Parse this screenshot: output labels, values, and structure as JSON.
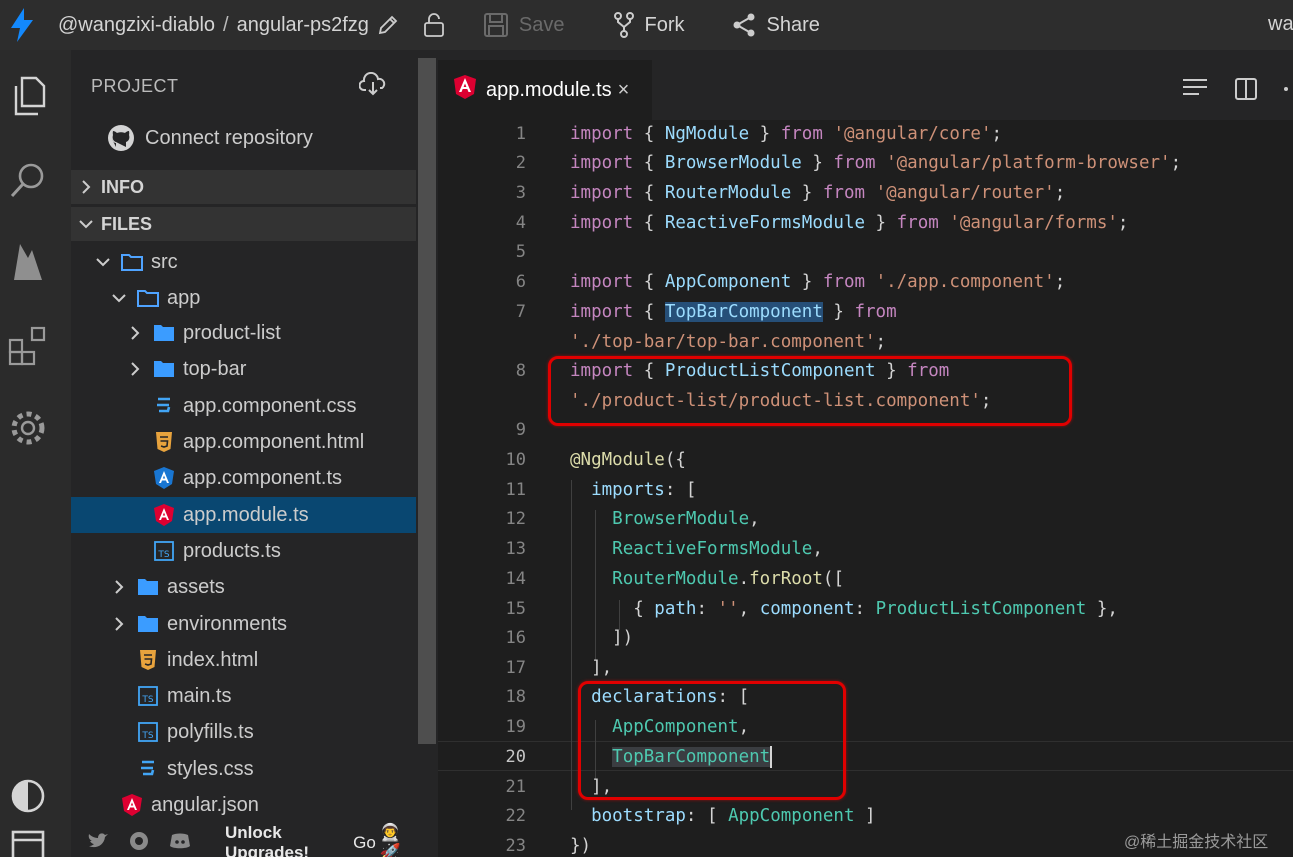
{
  "topbar": {
    "user": "@wangzixi-diablo",
    "separator": "/",
    "project": "angular-ps2fzg",
    "save_label": "Save",
    "fork_label": "Fork",
    "share_label": "Share",
    "right_truncated": "wa"
  },
  "activity": {
    "icons": [
      "files-icon",
      "search-icon",
      "firebase-icon",
      "extensions-icon",
      "settings-icon",
      "theme-icon",
      "layout-icon"
    ]
  },
  "sidebar": {
    "project_label": "PROJECT",
    "connect_label": "Connect repository",
    "info_label": "INFO",
    "files_label": "FILES",
    "tree": [
      {
        "label": "src",
        "type": "folder-open"
      },
      {
        "label": "app",
        "type": "folder-open"
      },
      {
        "label": "product-list",
        "type": "folder"
      },
      {
        "label": "top-bar",
        "type": "folder"
      },
      {
        "label": "app.component.css",
        "type": "css"
      },
      {
        "label": "app.component.html",
        "type": "html"
      },
      {
        "label": "app.component.ts",
        "type": "angular-ts"
      },
      {
        "label": "app.module.ts",
        "type": "angular"
      },
      {
        "label": "products.ts",
        "type": "ts"
      },
      {
        "label": "assets",
        "type": "folder"
      },
      {
        "label": "environments",
        "type": "folder"
      },
      {
        "label": "index.html",
        "type": "html"
      },
      {
        "label": "main.ts",
        "type": "ts"
      },
      {
        "label": "polyfills.ts",
        "type": "ts"
      },
      {
        "label": "styles.css",
        "type": "css"
      },
      {
        "label": "angular.json",
        "type": "angular"
      }
    ],
    "footer_promo": "Unlock Upgrades!",
    "footer_go": "Go",
    "footer_emoji": "👨‍🚀🚀"
  },
  "editor": {
    "tab_label": "app.module.ts",
    "tab_close": "×",
    "line_numbers": [
      "1",
      "2",
      "3",
      "4",
      "5",
      "6",
      "7",
      "8",
      "9",
      "10",
      "11",
      "12",
      "13",
      "14",
      "15",
      "16",
      "17",
      "18",
      "19",
      "20",
      "21",
      "22",
      "23"
    ],
    "current_line": "20"
  },
  "colors": {
    "accent": "#094771",
    "highlight_box": "#e00000",
    "keyword": "#c586c0",
    "class": "#4ec9b0",
    "string": "#ce9178",
    "property": "#9cdcfe"
  },
  "watermark": "@稀土掘金技术社区"
}
